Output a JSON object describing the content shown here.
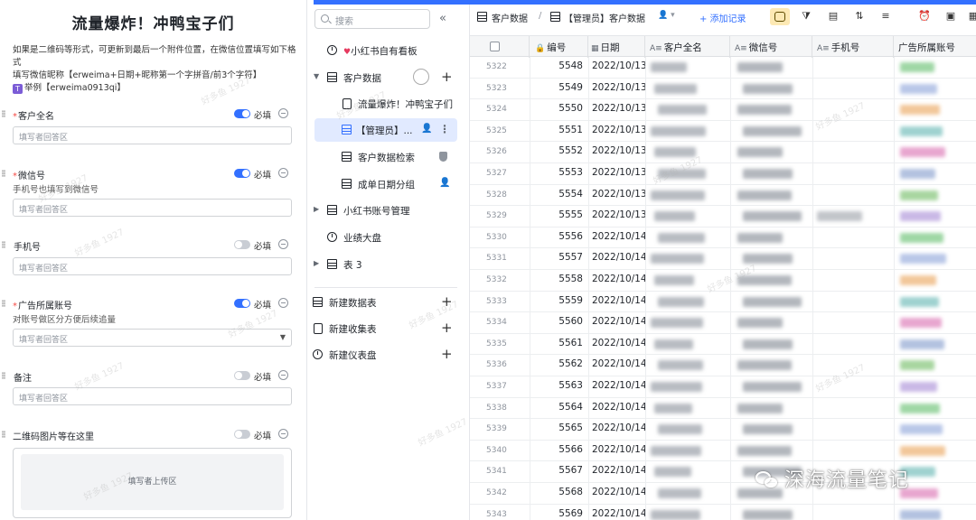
{
  "form": {
    "title": "流量爆炸！冲鸭宝子们",
    "description_line1": "如果是二维码等形式，可更新到最后一个附件位置，在微信位置填写如下格式",
    "description_line2": "填写微信昵称【erweima+日期+昵称第一个字拼音/前3个字符】",
    "description_example": "举例【erweima0913qi】",
    "required_label": "必填",
    "placeholder": "填写者回答区",
    "upload_placeholder": "填写者上传区",
    "watermark": "好多鱼 1927",
    "fields": [
      {
        "label": "客户全名",
        "required_marker": "*",
        "hint": "",
        "required": true
      },
      {
        "label": "微信号",
        "required_marker": "*",
        "hint": "手机号也填写到微信号",
        "required": true
      },
      {
        "label": "手机号",
        "required_marker": "",
        "hint": "",
        "required": false
      },
      {
        "label": "广告所属账号",
        "required_marker": "*",
        "hint": "对账号做区分方便后续追量",
        "required": true
      },
      {
        "label": "备注",
        "required_marker": "",
        "hint": "",
        "required": false
      },
      {
        "label": "二维码图片等在这里",
        "required_marker": "",
        "hint": "",
        "required": false
      }
    ]
  },
  "nav": {
    "search_placeholder": "搜索",
    "collapse_icon": "«",
    "items": [
      {
        "label": "小红书自有看板",
        "icon": "dashboard-icon"
      },
      {
        "label": "客户数据",
        "icon": "table-icon"
      },
      {
        "label": "流量爆炸！冲鸭宝子们",
        "icon": "form-icon"
      },
      {
        "label": "【管理员】...",
        "icon": "grid-view-icon"
      },
      {
        "label": "客户数据检索",
        "icon": "grid-view-icon"
      },
      {
        "label": "成单日期分组",
        "icon": "grid-view-icon"
      },
      {
        "label": "小红书账号管理",
        "icon": "table-icon"
      },
      {
        "label": "业绩大盘",
        "icon": "dashboard-icon"
      },
      {
        "label": "表 3",
        "icon": "table-icon"
      }
    ],
    "actions": [
      {
        "label": "新建数据表",
        "icon": "table-add-icon"
      },
      {
        "label": "新建收集表",
        "icon": "form-add-icon"
      },
      {
        "label": "新建仪表盘",
        "icon": "dashboard-add-icon"
      }
    ]
  },
  "table": {
    "breadcrumb_root": "客户数据",
    "breadcrumb_sep": "/",
    "breadcrumb_view": "【管理员】客户数据",
    "add_record": "+ 添加记录",
    "columns": [
      "编号",
      "日期",
      "客户全名",
      "微信号",
      "手机号",
      "广告所属账号"
    ],
    "rows": [
      {
        "index": "5322",
        "num": "5548",
        "date": "2022/10/13"
      },
      {
        "index": "5323",
        "num": "5549",
        "date": "2022/10/13"
      },
      {
        "index": "5324",
        "num": "5550",
        "date": "2022/10/13"
      },
      {
        "index": "5325",
        "num": "5551",
        "date": "2022/10/13"
      },
      {
        "index": "5326",
        "num": "5552",
        "date": "2022/10/13"
      },
      {
        "index": "5327",
        "num": "5553",
        "date": "2022/10/13"
      },
      {
        "index": "5328",
        "num": "5554",
        "date": "2022/10/13"
      },
      {
        "index": "5329",
        "num": "5555",
        "date": "2022/10/13"
      },
      {
        "index": "5330",
        "num": "5556",
        "date": "2022/10/14"
      },
      {
        "index": "5331",
        "num": "5557",
        "date": "2022/10/14"
      },
      {
        "index": "5332",
        "num": "5558",
        "date": "2022/10/14"
      },
      {
        "index": "5333",
        "num": "5559",
        "date": "2022/10/14"
      },
      {
        "index": "5334",
        "num": "5560",
        "date": "2022/10/14"
      },
      {
        "index": "5335",
        "num": "5561",
        "date": "2022/10/14"
      },
      {
        "index": "5336",
        "num": "5562",
        "date": "2022/10/14"
      },
      {
        "index": "5337",
        "num": "5563",
        "date": "2022/10/14"
      },
      {
        "index": "5338",
        "num": "5564",
        "date": "2022/10/14"
      },
      {
        "index": "5339",
        "num": "5565",
        "date": "2022/10/14"
      },
      {
        "index": "5340",
        "num": "5566",
        "date": "2022/10/14"
      },
      {
        "index": "5341",
        "num": "5567",
        "date": "2022/10/14"
      },
      {
        "index": "5342",
        "num": "5568",
        "date": "2022/10/14"
      },
      {
        "index": "5343",
        "num": "5569",
        "date": "2022/10/14"
      }
    ]
  },
  "brand_watermark": "深海流量笔记",
  "colors": {
    "accent": "#3370ff",
    "required": "#f54a45",
    "selected_nav": "#e1eaff"
  }
}
